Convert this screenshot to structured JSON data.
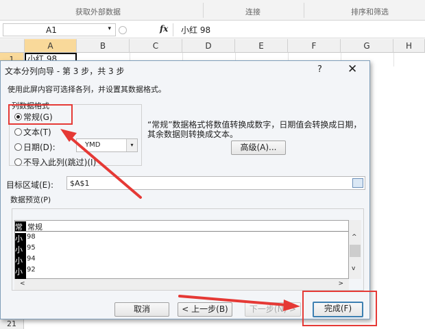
{
  "ribbon": {
    "groups": [
      "获取外部数据",
      "连接",
      "排序和筛选"
    ]
  },
  "formula_bar": {
    "name_box": "A1",
    "dropdown_glyph": "▾",
    "fx_label": "fx",
    "value": "小红  98"
  },
  "sheet": {
    "columns": [
      "A",
      "B",
      "C",
      "D",
      "E",
      "F",
      "G",
      "H"
    ],
    "rows": [
      "1",
      "21"
    ],
    "cell_a1": "小红  98"
  },
  "dialog": {
    "title": "文本分列向导 - 第 3 步，共 3 步",
    "help": "?",
    "close": "✕",
    "description": "使用此屏内容可选择各列，并设置其数据格式。",
    "group_title": "列数据格式",
    "options": [
      {
        "label": "常规(G)",
        "selected": true
      },
      {
        "label": "文本(T)",
        "selected": false
      },
      {
        "label": "日期(D):",
        "selected": false
      },
      {
        "label": "不导入此列(跳过)(I)",
        "selected": false
      }
    ],
    "date_format": "YMD",
    "dropdown_glyph": "▾",
    "info_text": "“常规”数据格式将数值转换成数字，日期值会转换成日期，其余数据则转换成文本。",
    "advanced_button": "高级(A)...",
    "target_label": "目标区域(E):",
    "target_value": "$A$1",
    "preview_label": "数据预览(P)",
    "preview": {
      "headers": [
        "常规",
        "常规"
      ],
      "rows": [
        [
          "小红",
          "98"
        ],
        [
          "小明",
          "95"
        ],
        [
          "小刚",
          "94"
        ],
        [
          "小刘",
          "92"
        ]
      ],
      "scroll_up": "^",
      "scroll_down": "v",
      "scroll_left": "<",
      "scroll_right": ">"
    },
    "buttons": {
      "cancel": "取消",
      "back": "< 上一步(B)",
      "next": "下一步(N) >",
      "finish": "完成(F)"
    }
  },
  "colors": {
    "annotation": "#e53935",
    "accent": "#3c7fb1",
    "selected_header": "#f9d99a"
  }
}
